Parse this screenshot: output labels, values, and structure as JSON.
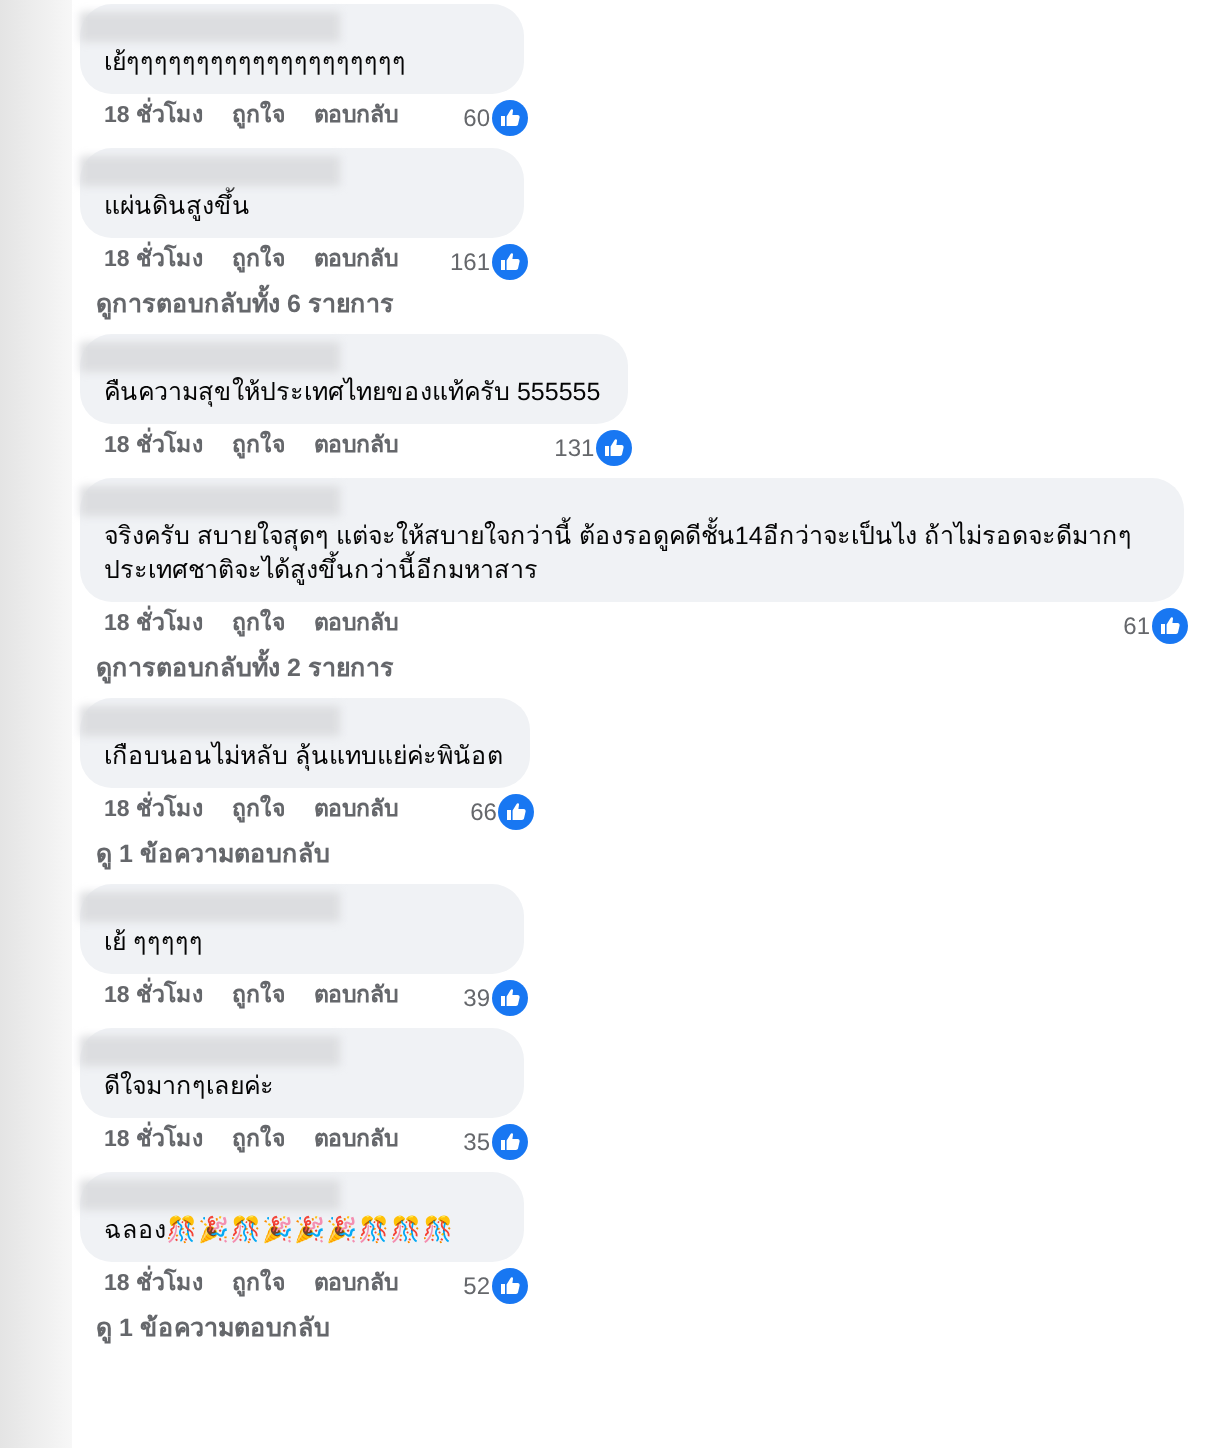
{
  "comments": [
    {
      "text": "เย้ๆๆๆๆๆๆๆๆๆๆๆๆๆๆๆๆๆๆๆๆ",
      "time": "18 ชั่วโมง",
      "like": "ถูกใจ",
      "reply": "ตอบกลับ",
      "likes": "60"
    },
    {
      "text": "แผ่นดินสูงขึ้น",
      "time": "18 ชั่วโมง",
      "like": "ถูกใจ",
      "reply": "ตอบกลับ",
      "likes": "161",
      "replies_link": "ดูการตอบกลับทั้ง 6 รายการ"
    },
    {
      "text": "คืนความสุขให้ประเทศไทยของแท้ครับ 555555",
      "time": "18 ชั่วโมง",
      "like": "ถูกใจ",
      "reply": "ตอบกลับ",
      "likes": "131"
    },
    {
      "text": "จริงครับ สบายใจสุดๆ แต่จะให้สบายใจกว่านี้ ต้องรอดูคดีชั้น14อีกว่าจะเป็นไง ถ้าไม่รอดจะดีมากๆ ประเทศชาติจะได้สูงขึ้นกว่านี้อีกมหาสาร",
      "time": "18 ชั่วโมง",
      "like": "ถูกใจ",
      "reply": "ตอบกลับ",
      "likes": "61",
      "replies_link": "ดูการตอบกลับทั้ง 2 รายการ"
    },
    {
      "text": "เกือบนอนไม่หลับ ลุ้นแทบแย่ค่ะพินัอต",
      "time": "18 ชั่วโมง",
      "like": "ถูกใจ",
      "reply": "ตอบกลับ",
      "likes": "66",
      "replies_link": "ดู 1 ข้อความตอบกลับ"
    },
    {
      "text": "เย้ ๆๆๆๆๆ",
      "time": "18 ชั่วโมง",
      "like": "ถูกใจ",
      "reply": "ตอบกลับ",
      "likes": "39"
    },
    {
      "text": "ดีใจมากๆเลยค่ะ",
      "time": "18 ชั่วโมง",
      "like": "ถูกใจ",
      "reply": "ตอบกลับ",
      "likes": "35"
    },
    {
      "text": "ฉลอง🎊🎉🎊🎉🎉🎉🎊🎊🎊",
      "time": "18 ชั่วโมง",
      "like": "ถูกใจ",
      "reply": "ตอบกลับ",
      "likes": "52",
      "replies_link": "ดู 1 ข้อความตอบกลับ"
    }
  ]
}
